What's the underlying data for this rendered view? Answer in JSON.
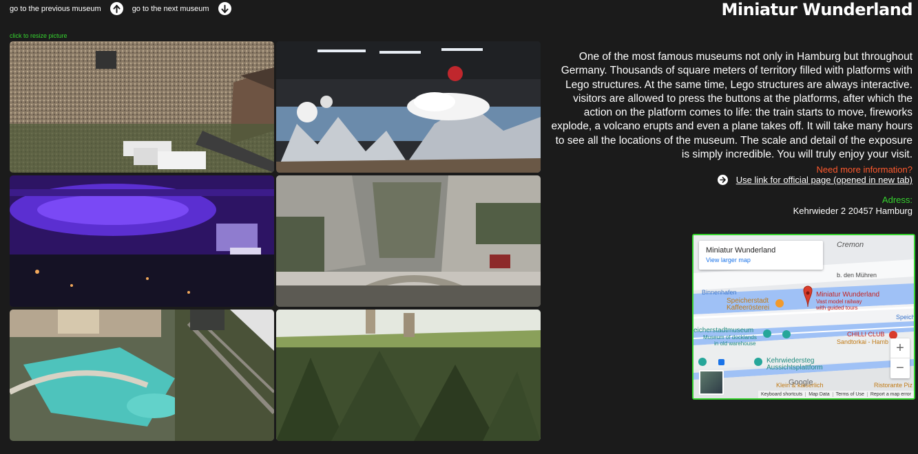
{
  "nav": {
    "prev_label": "go to the previous museum",
    "next_label": "go to the next museum"
  },
  "title": "Miniatur Wunderland",
  "resize_hint": "click to resize picture",
  "gallery": {
    "photos": [
      {
        "icon": "photo-concert-crowd"
      },
      {
        "icon": "photo-alps-balloons"
      },
      {
        "icon": "photo-purple-stadium"
      },
      {
        "icon": "photo-canyon-bridge"
      },
      {
        "icon": "photo-water-park"
      },
      {
        "icon": "photo-forest-castle"
      }
    ]
  },
  "description": "One of the most famous museums not only in Hamburg but throughout Germany. Thousands of square meters of territory filled with platforms with Lego structures. At the same time, Lego structures are always interactive. visitors are allowed to press the buttons at the platforms, after which the action on the platform comes to life: the train starts to move, fireworks explode, a volcano erupts and even a plane takes off. It will take many hours to see all the locations of the museum. The scale and detail of the exposure is simply incredible. You will truly enjoy your visit.",
  "info": {
    "more_label": "Need more information?",
    "link_label": " Use link for official page (opened in new tab)",
    "address_label": "Adress:",
    "address": "Kehrwieder 2 20457 Hamburg"
  },
  "map": {
    "card_name": "Miniatur Wunderland",
    "card_link": "View larger map",
    "labels": {
      "cremon": "Cremon",
      "muhren": "b. den Mühren",
      "binnenhafen": "Binnenhafen",
      "kaffee_1": "Speicherstadt",
      "kaffee_2": "Kaffeerösterei",
      "place_1": "Miniatur Wunderland",
      "place_2": "Vast model railway",
      "place_3": "with guided tours",
      "speiche": "Speiche",
      "museum_1": "eicherstadtmuseum",
      "museum_2": "Museum of docklands",
      "museum_3": "in old warehouse",
      "chilli": "CHILLI CLUB",
      "sandtorkai": "Sandtorkai - Hamb",
      "kehr_1": "Kehrwiedersteg",
      "kehr_2": "Aussichtsplattform",
      "klein": "Klein & kaiserlich",
      "ristorante": "Ristorante Piz",
      "google": "Google"
    },
    "attribution": [
      "Keyboard shortcuts",
      "Map Data",
      "Terms of Use",
      "Report a map error"
    ],
    "zoom_in": "+",
    "zoom_out": "−"
  },
  "colors": {
    "background": "#1b1b1b",
    "accent_green": "#36d42f",
    "accent_orange": "#ff5a2e"
  }
}
